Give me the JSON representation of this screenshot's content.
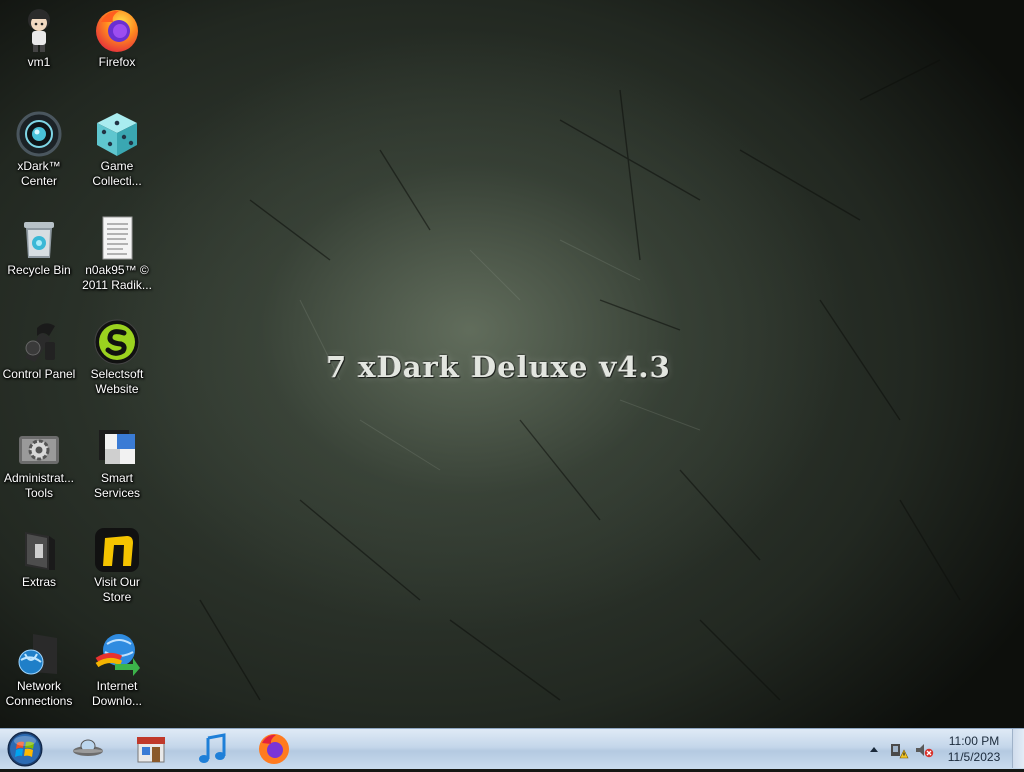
{
  "wallpaper": {
    "title": "7 xDark Deluxe v4.3"
  },
  "desktop_icons": [
    {
      "label": "vm1",
      "icon": "user-figure-icon"
    },
    {
      "label": "Firefox",
      "icon": "firefox-icon"
    },
    {
      "label": "xDark™\nCenter",
      "icon": "xdark-center-icon"
    },
    {
      "label": "Game\nCollecti...",
      "icon": "dice-icon"
    },
    {
      "label": "Recycle Bin",
      "icon": "recycle-bin-icon"
    },
    {
      "label": "n0ak95™ ©\n2011 Radik...",
      "icon": "text-document-icon"
    },
    {
      "label": "Control Panel",
      "icon": "control-panel-icon"
    },
    {
      "label": "Selectsoft\nWebsite",
      "icon": "selectsoft-icon"
    },
    {
      "label": "Administrat...\nTools",
      "icon": "admin-tools-gear-icon"
    },
    {
      "label": "Smart\nServices",
      "icon": "smart-services-icon"
    },
    {
      "label": "Extras",
      "icon": "extras-folder-icon"
    },
    {
      "label": "Visit Our\nStore",
      "icon": "store-n-icon"
    },
    {
      "label": "Network\nConnections",
      "icon": "network-globe-icon"
    },
    {
      "label": "Internet\nDownlo...",
      "icon": "internet-download-manager-icon"
    }
  ],
  "taskbar": {
    "start_icon": "windows-start-orb-icon",
    "pinned": [
      "ufo-app-icon",
      "store-app-icon",
      "music-note-icon",
      "firefox-icon"
    ],
    "tray_icons": [
      "show-hidden-arrow-icon",
      "network-warning-icon",
      "volume-muted-icon"
    ],
    "clock": {
      "time": "11:00 PM",
      "date": "11/5/2023"
    }
  }
}
